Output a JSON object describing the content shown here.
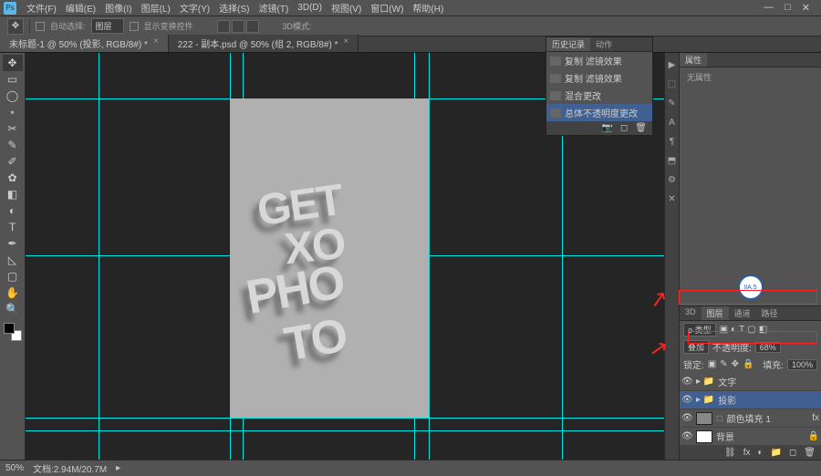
{
  "menu": {
    "items": [
      "文件(F)",
      "编辑(E)",
      "图像(I)",
      "图层(L)",
      "文字(Y)",
      "选择(S)",
      "滤镜(T)",
      "3D(D)",
      "视图(V)",
      "窗口(W)",
      "帮助(H)"
    ]
  },
  "optionbar": {
    "auto_select": "自动选择:",
    "layer": "图层",
    "show_transform": "显示变换控件",
    "mode_3d": "3D模式:"
  },
  "tabs": [
    {
      "label": "未标题-1 @ 50% (投影, RGB/8#) *"
    },
    {
      "label": "222 - 副本.psd @ 50% (组 2, RGB/8#) *"
    }
  ],
  "history": {
    "tabs": [
      "历史记录",
      "动作"
    ],
    "items": [
      "复制 滤镜效果",
      "复制 滤镜效果",
      "混合更改",
      "总体不透明度更改"
    ]
  },
  "properties": {
    "tab": "属性",
    "none": "无属性"
  },
  "layers": {
    "tabs": [
      "3D",
      "图层",
      "通道",
      "路径"
    ],
    "kind": "ρ 类型",
    "blend": "叠加",
    "opacity_label": "不透明度:",
    "opacity": "68%",
    "lock": "锁定:",
    "fill_label": "填充:",
    "fill": "100%",
    "items": [
      {
        "name": "文字",
        "folder": true
      },
      {
        "name": "投影",
        "folder": true,
        "sel": true
      },
      {
        "name": "颜色填充 1",
        "folder": false,
        "fx": true
      },
      {
        "name": "背景",
        "folder": false
      }
    ]
  },
  "status": {
    "zoom": "50%",
    "doc": "文档:2.94M/20.7M"
  }
}
